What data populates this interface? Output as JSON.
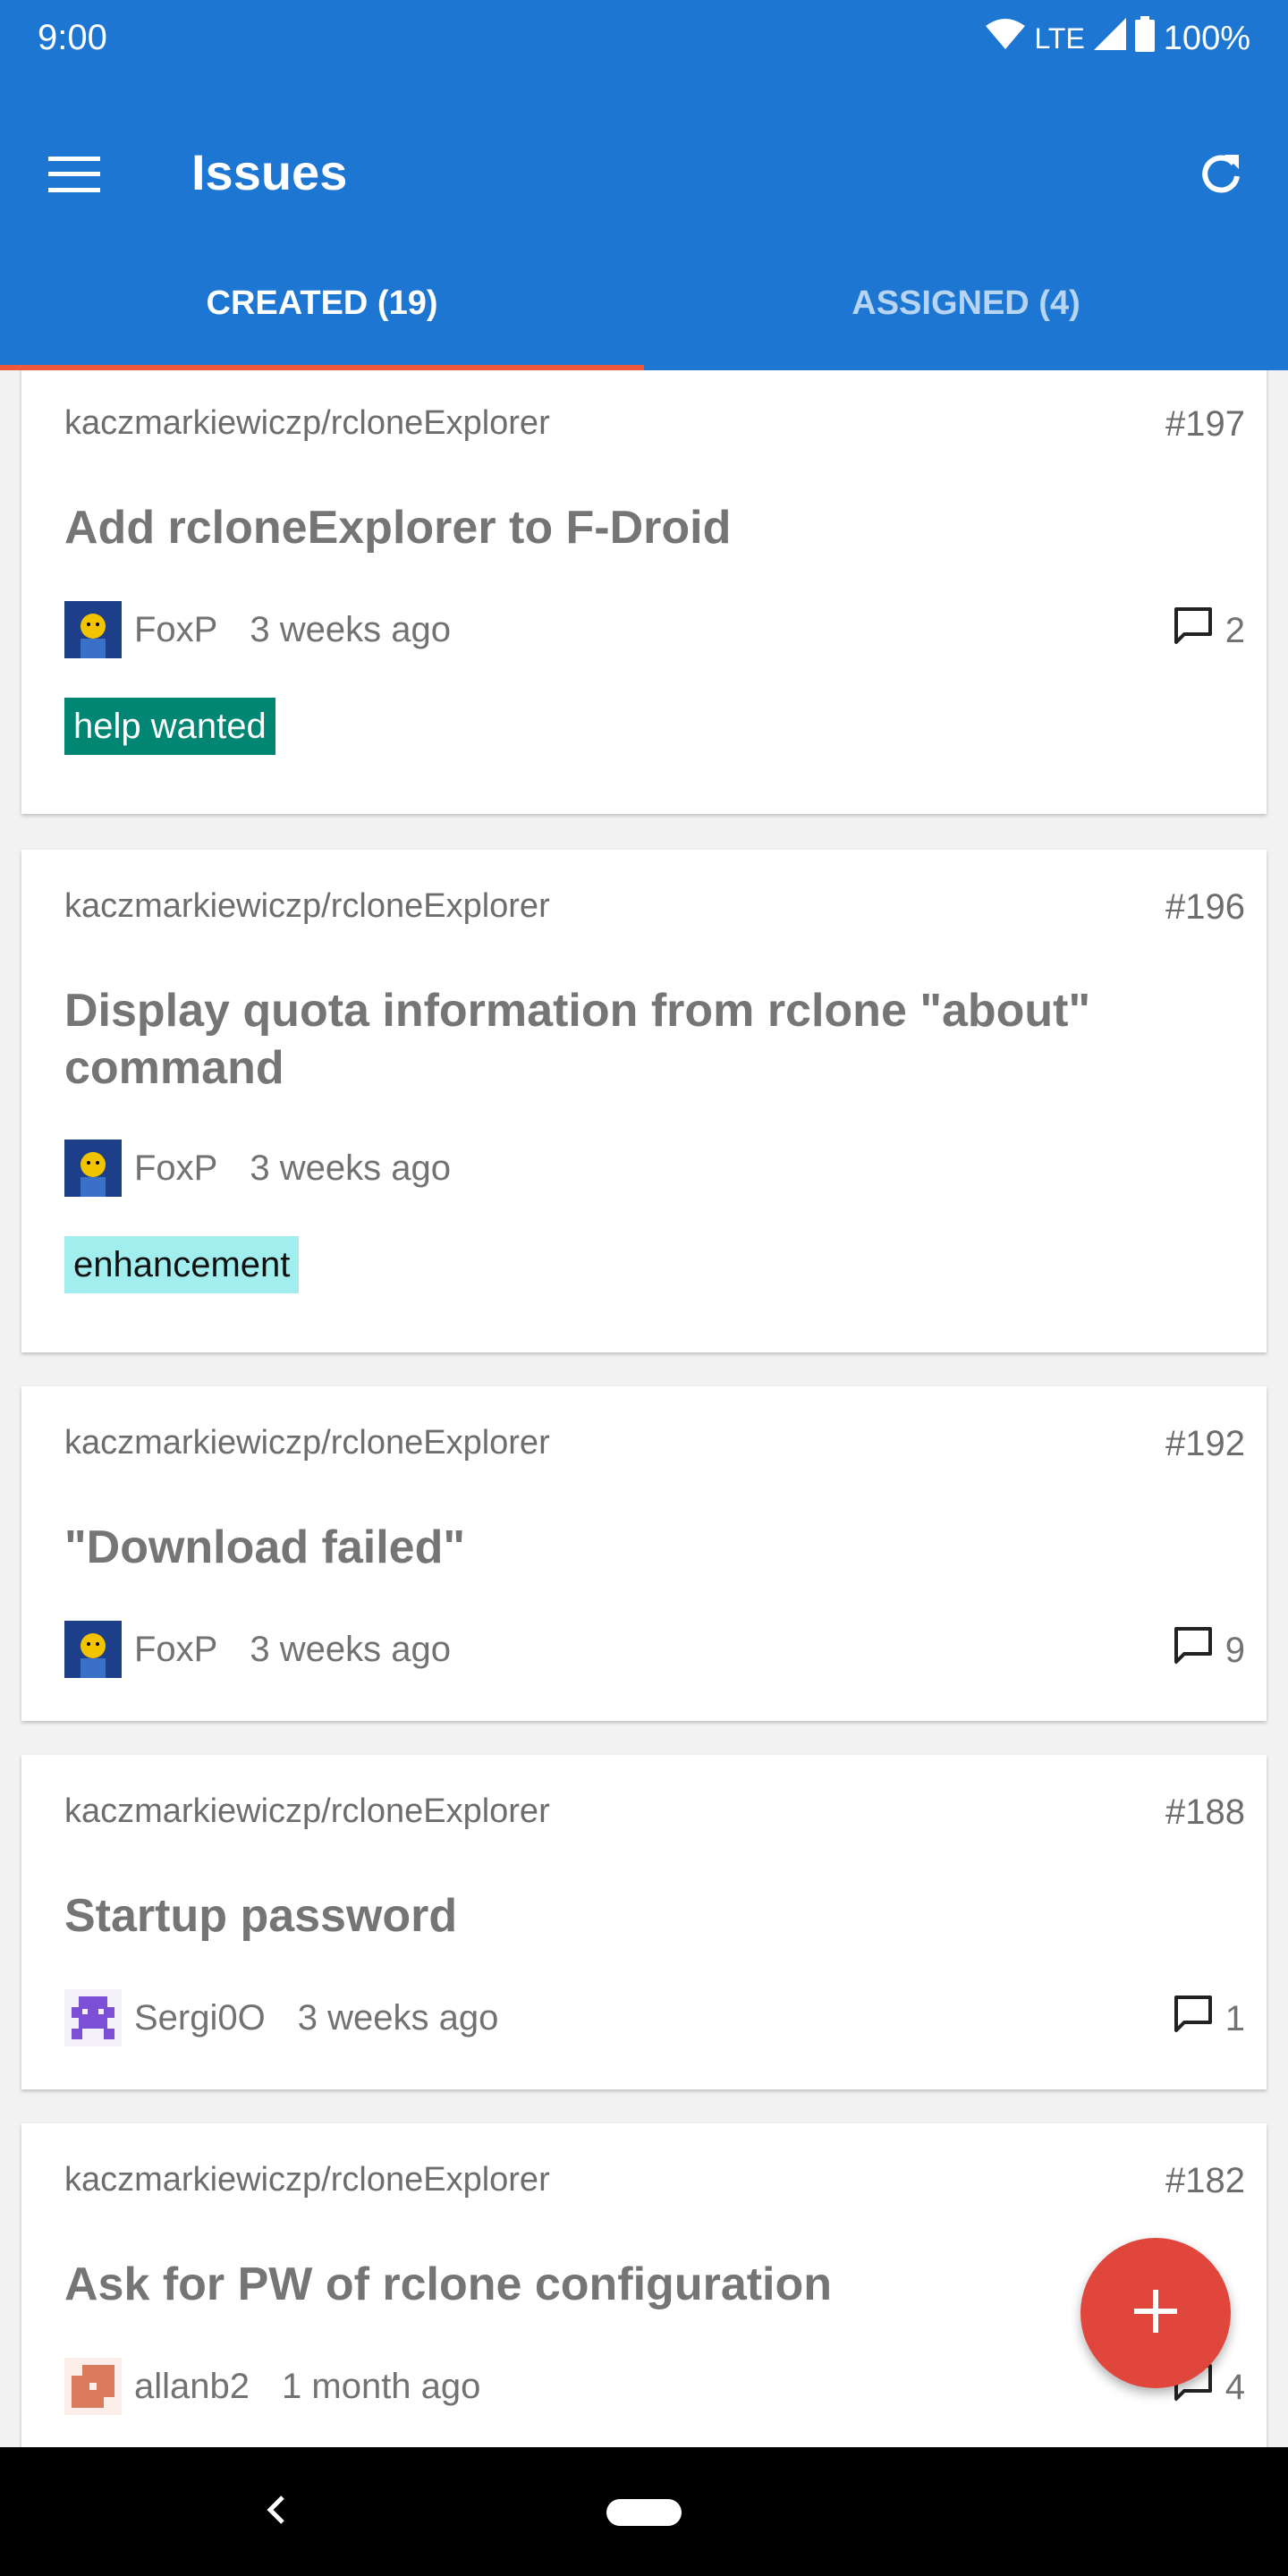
{
  "status_bar": {
    "time": "9:00",
    "network": "LTE",
    "battery": "100%"
  },
  "app_bar": {
    "title": "Issues",
    "menu_icon": "menu-icon",
    "refresh_icon": "refresh-icon",
    "tabs": [
      {
        "label": "CREATED (19)",
        "active": true
      },
      {
        "label": "ASSIGNED (4)",
        "active": false
      }
    ],
    "colors": {
      "primary": "#1c76d2",
      "indicator": "#f0583e"
    }
  },
  "issues": [
    {
      "repo": "kaczmarkiewiczp/rcloneExplorer",
      "number": "#197",
      "title": "Add rcloneExplorer to F-Droid",
      "user": "FoxP",
      "time": "3 weeks ago",
      "comments": "2",
      "label": "help wanted",
      "label_color": "#008672"
    },
    {
      "repo": "kaczmarkiewiczp/rcloneExplorer",
      "number": "#196",
      "title": "Display quota information from rclone \"about\" command",
      "user": "FoxP",
      "time": "3 weeks ago",
      "comments": "",
      "label": "enhancement",
      "label_color": "#a2eeef"
    },
    {
      "repo": "kaczmarkiewiczp/rcloneExplorer",
      "number": "#192",
      "title": "\"Download failed\"",
      "user": "FoxP",
      "time": "3 weeks ago",
      "comments": "9",
      "label": ""
    },
    {
      "repo": "kaczmarkiewiczp/rcloneExplorer",
      "number": "#188",
      "title": "Startup password",
      "user": "Sergi0O",
      "time": "3 weeks ago",
      "comments": "1",
      "label": ""
    },
    {
      "repo": "kaczmarkiewiczp/rcloneExplorer",
      "number": "#182",
      "title": "Ask for PW of rclone configuration",
      "user": "allanb2",
      "time": "1 month ago",
      "comments": "4",
      "label": ""
    }
  ],
  "fab": {
    "icon": "add-icon",
    "color": "#e0463c"
  }
}
